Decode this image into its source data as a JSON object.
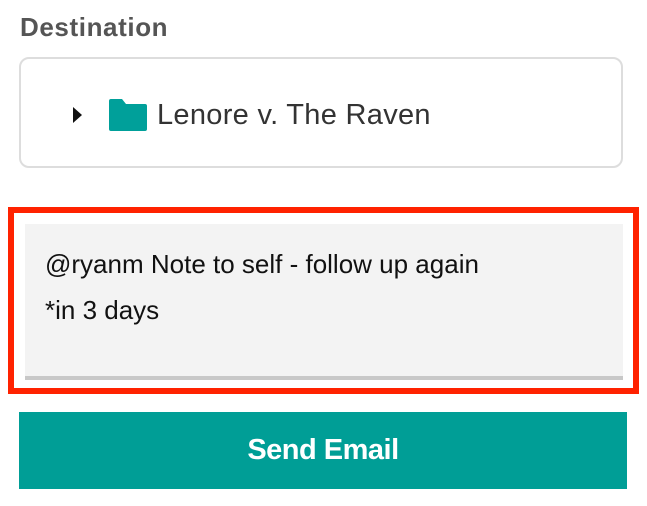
{
  "destination": {
    "label": "Destination",
    "folder": {
      "name": "Lenore v. The Raven",
      "icon": "folder-icon",
      "expander_icon": "caret-right-icon",
      "color": "#00a09a"
    }
  },
  "note": {
    "value": "@ryanm Note to self - follow up again\n*in 3 days"
  },
  "send": {
    "label": "Send Email",
    "color": "#009e96"
  },
  "highlight_color": "#ff2200"
}
